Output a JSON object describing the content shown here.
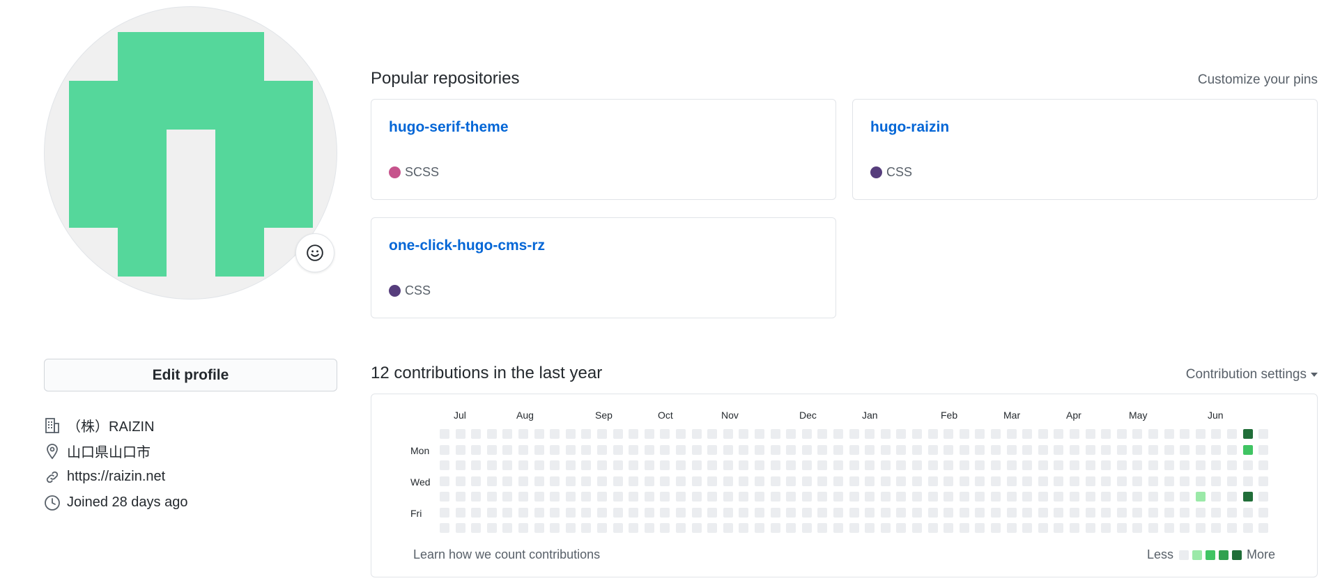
{
  "profile": {
    "edit_label": "Edit profile",
    "company": "（株）RAIZIN",
    "location": "山口県山口市",
    "website": "https://raizin.net",
    "joined": "Joined 28 days ago",
    "avatar_color": "#55d79b",
    "avatar_bg": "#f0f0f0"
  },
  "repos": {
    "title": "Popular repositories",
    "customize_label": "Customize your pins",
    "items": [
      {
        "name": "hugo-serif-theme",
        "language": "SCSS",
        "lang_color": "#c6538c"
      },
      {
        "name": "hugo-raizin",
        "language": "CSS",
        "lang_color": "#563d7c"
      },
      {
        "name": "one-click-hugo-cms-rz",
        "language": "CSS",
        "lang_color": "#563d7c"
      }
    ]
  },
  "contrib": {
    "title": "12 contributions in the last year",
    "settings_label": "Contribution settings",
    "months": [
      "Jul",
      "Aug",
      "Sep",
      "Oct",
      "Nov",
      "Dec",
      "Jan",
      "Feb",
      "Mar",
      "Apr",
      "May",
      "Jun"
    ],
    "days": [
      "Mon",
      "Wed",
      "Fri"
    ],
    "learn_label": "Learn how we count contributions",
    "less_label": "Less",
    "more_label": "More",
    "colors": [
      "#ebedf0",
      "#9be9a8",
      "#40c463",
      "#30a14e",
      "#216e39"
    ],
    "weeks": 53,
    "last_week_days": 7,
    "active": [
      {
        "week": 48,
        "day": 4,
        "level": 1
      },
      {
        "week": 51,
        "day": 0,
        "level": 4
      },
      {
        "week": 51,
        "day": 1,
        "level": 2
      },
      {
        "week": 51,
        "day": 4,
        "level": 4
      }
    ]
  }
}
